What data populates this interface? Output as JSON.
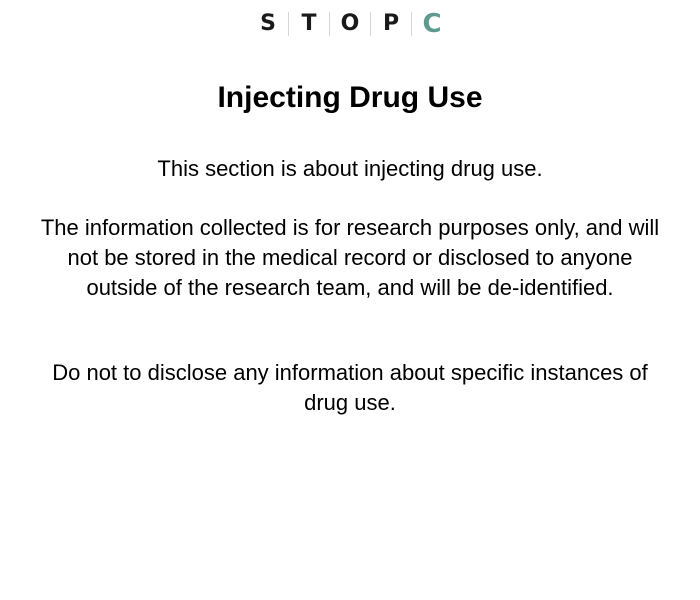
{
  "logo": {
    "letters": [
      "S",
      "T",
      "O",
      "P",
      "C"
    ],
    "accent_color": "#5e9b8e"
  },
  "page": {
    "title": "Injecting Drug Use",
    "paragraphs": [
      "This section is about injecting drug use.",
      "The information collected is for research purposes only, and will not be stored in the medical record or disclosed to anyone outside of the research team, and will be de-identified.",
      "Do not to disclose any information about specific instances of drug use."
    ]
  }
}
